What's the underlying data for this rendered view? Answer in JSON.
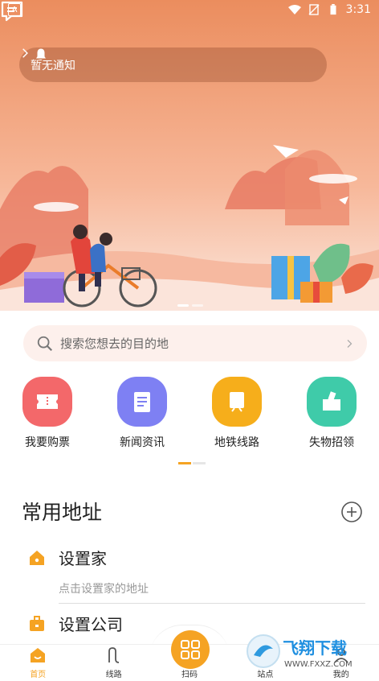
{
  "status_bar": {
    "time": "3:31",
    "app_badge": "A"
  },
  "notice": {
    "text": "暂无通知"
  },
  "search": {
    "placeholder": "搜索您想去的目的地"
  },
  "shortcuts": [
    {
      "label": "我要购票",
      "icon": "ticket-icon",
      "color": "#f3686a"
    },
    {
      "label": "新闻资讯",
      "icon": "news-icon",
      "color": "#7e80f3"
    },
    {
      "label": "地铁线路",
      "icon": "metro-icon",
      "color": "#f6ae1b"
    },
    {
      "label": "失物招领",
      "icon": "lost-found-icon",
      "color": "#3fcba9"
    }
  ],
  "common_address": {
    "title": "常用地址",
    "items": [
      {
        "name": "设置家",
        "hint": "点击设置家的地址",
        "icon": "home-icon"
      },
      {
        "name": "设置公司",
        "hint": "",
        "icon": "briefcase-icon"
      }
    ]
  },
  "tabbar": {
    "items": [
      {
        "label": "首页",
        "icon": "home-tab-icon",
        "active": true
      },
      {
        "label": "线路",
        "icon": "route-icon",
        "active": false
      },
      {
        "label": "扫码",
        "icon": "qr-scan-icon",
        "active": false
      },
      {
        "label": "站点",
        "icon": "station-icon",
        "active": false
      },
      {
        "label": "我的",
        "icon": "profile-icon",
        "active": false
      }
    ]
  },
  "watermark": {
    "text": "飞翔下载",
    "url": "WWW.FXXZ.COM"
  },
  "colors": {
    "accent": "#f5a323",
    "hero_top": "#eb8d5e"
  }
}
